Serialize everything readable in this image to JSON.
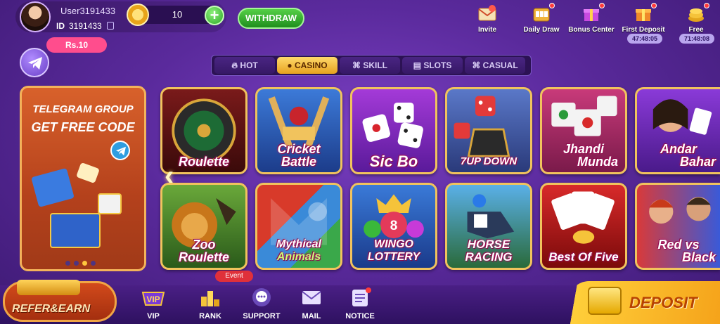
{
  "header": {
    "username": "User3191433",
    "id_label": "ID",
    "id_value": "3191433",
    "balance": "10",
    "plus": "+",
    "withdraw": "WITHDRAW"
  },
  "top_icons": [
    {
      "label": "Invite",
      "icon": "invite-envelope-icon"
    },
    {
      "label": "Daily Draw",
      "icon": "daily-draw-icon"
    },
    {
      "label": "Bonus Center",
      "icon": "bonus-gift-icon"
    },
    {
      "label": "First Deposit",
      "icon": "first-deposit-icon",
      "timer": "47:48:05"
    },
    {
      "label": "Free",
      "icon": "free-coins-icon",
      "timer": "71:48:08"
    }
  ],
  "telegram_reward": "Rs.10",
  "tabs": [
    {
      "label": "HOT",
      "icon": "flame-icon"
    },
    {
      "label": "CASINO",
      "icon": "person-icon",
      "active": true
    },
    {
      "label": "SKILL",
      "icon": "gamepad-icon"
    },
    {
      "label": "SLOTS",
      "icon": "slots-icon"
    },
    {
      "label": "CASUAL",
      "icon": "gamepad-icon"
    }
  ],
  "banner": {
    "line1": "TELEGRAM GROUP",
    "line2": "GET FREE CODE",
    "active_dot": 3,
    "dots": 4
  },
  "games": [
    {
      "line1": "Roulette",
      "line2": ""
    },
    {
      "line1": "Cricket",
      "line2": "Battle"
    },
    {
      "line1": "Sic Bo",
      "line2": ""
    },
    {
      "line1": "7UP DOWN",
      "line2": ""
    },
    {
      "line1": "Jhandi",
      "line2": "Munda"
    },
    {
      "line1": "Andar",
      "line2": "Bahar"
    },
    {
      "line1": "Zoo",
      "line2": "Roulette"
    },
    {
      "line1": "Mythical",
      "line2": "Animals"
    },
    {
      "line1": "WINGO",
      "line2": "LOTTERY"
    },
    {
      "line1": "HORSE",
      "line2": "RACING"
    },
    {
      "line1": "Best Of Five",
      "line2": ""
    },
    {
      "line1": "Red vs",
      "line2": "Black"
    }
  ],
  "bottom_nav": [
    {
      "label": "VIP",
      "icon": "vip-badge-icon"
    },
    {
      "label": "RANK",
      "icon": "rank-trophy-icon"
    },
    {
      "label": "SUPPORT",
      "icon": "support-chat-icon"
    },
    {
      "label": "MAIL",
      "icon": "mail-icon"
    },
    {
      "label": "NOTICE",
      "icon": "notice-icon"
    }
  ],
  "event_badge": "Event",
  "refer_earn": "REFER&EARN",
  "deposit": "DEPOSIT",
  "colors": {
    "background": "#5a2a9c",
    "accent_gold": "#f1c35d",
    "withdraw_green": "#1f8e1d",
    "deposit_yellow": "#ffcf3a"
  }
}
